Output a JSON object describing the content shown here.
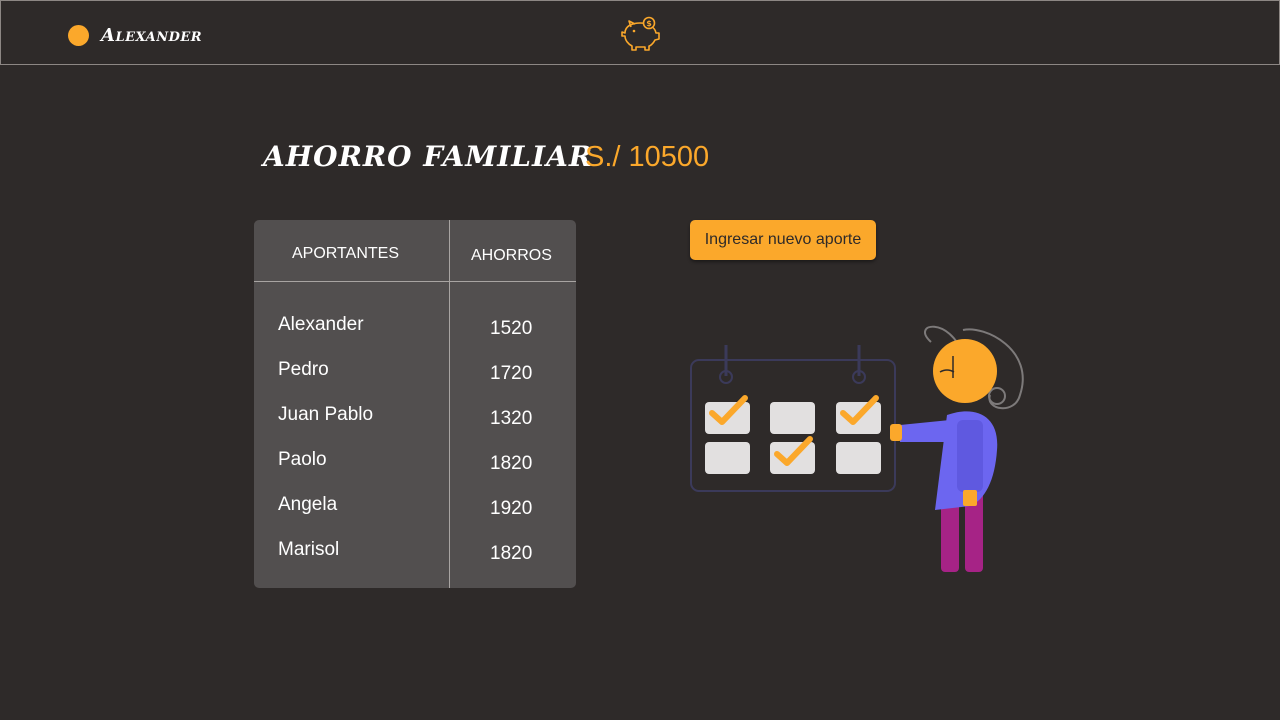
{
  "header": {
    "user_name": "Alexander",
    "user_dot_color": "#fba82b",
    "logo_icon": "piggy-bank-icon"
  },
  "main": {
    "title": "AHORRO FAMILIAR",
    "total": "S./ 10500",
    "add_button_label": "Ingresar nuevo aporte"
  },
  "table": {
    "headers": [
      "APORTANTES",
      "AHORROS"
    ],
    "rows": [
      {
        "name": "Alexander",
        "amount": "1520"
      },
      {
        "name": "Pedro",
        "amount": "1720"
      },
      {
        "name": "Juan Pablo",
        "amount": "1320"
      },
      {
        "name": "Paolo",
        "amount": "1820"
      },
      {
        "name": "Angela",
        "amount": "1920"
      },
      {
        "name": "Marisol",
        "amount": "1820"
      }
    ]
  },
  "colors": {
    "background": "#2e2a29",
    "accent": "#fba82b",
    "table_bg": "#524f4f"
  }
}
